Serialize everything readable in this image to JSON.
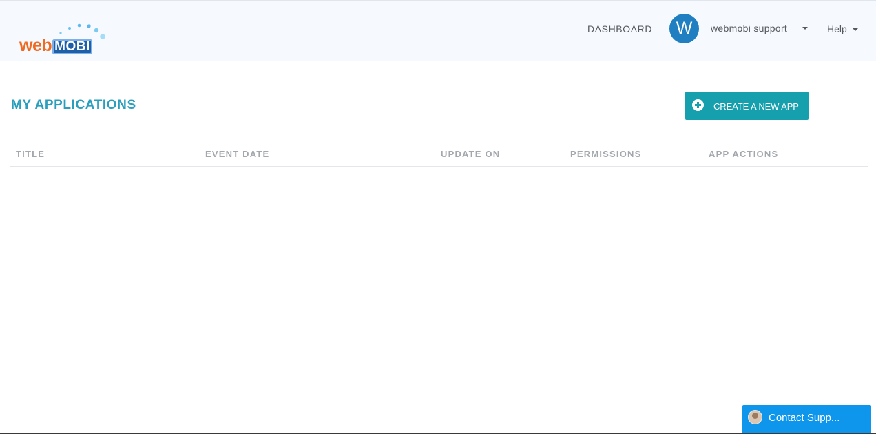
{
  "header": {
    "logo": {
      "text_web": "web",
      "text_mobi": "MOBI",
      "colors": {
        "web": "#f06b22",
        "mobi": "#1f5fa8",
        "dots": "#5bb8f0"
      }
    },
    "nav": {
      "dashboard_label": "DASHBOARD",
      "avatar_initial": "W",
      "user_name": "webmobi support",
      "help_label": "Help"
    }
  },
  "main": {
    "page_title": "MY APPLICATIONS",
    "create_button_label": "CREATE A NEW APP",
    "table": {
      "columns": [
        "TITLE",
        "EVENT DATE",
        "UPDATE ON",
        "PERMISSIONS",
        "APP ACTIONS"
      ],
      "rows": []
    }
  },
  "chat": {
    "label": "Contact Supp..."
  },
  "colors": {
    "accent": "#2a9fbd",
    "button": "#16a0ad",
    "avatar": "#1f7fc1",
    "chat": "#0d96ec"
  }
}
